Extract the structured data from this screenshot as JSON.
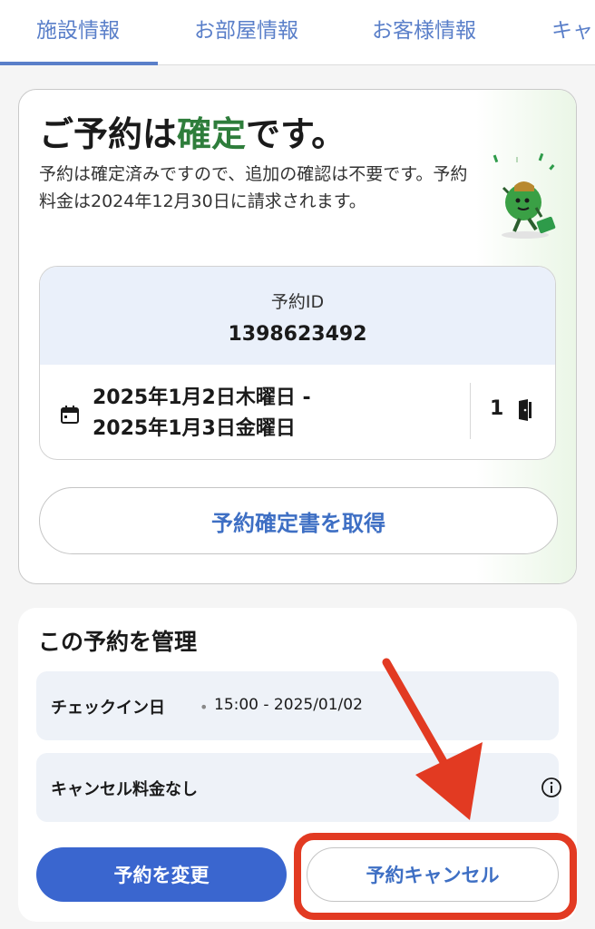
{
  "tabs": [
    {
      "label": "施設情報",
      "active": true
    },
    {
      "label": "お部屋情報"
    },
    {
      "label": "お客様情報"
    },
    {
      "label": "キャ"
    }
  ],
  "confirmation": {
    "title_prefix": "ご予約は",
    "title_accent": "確定",
    "title_suffix": "です。",
    "description": "予約は確定済みですので、追加の確認は不要です。予約料金は2024年12月30日に請求されます。",
    "booking_id_label": "予約ID",
    "booking_id": "1398623492",
    "date_line1": "2025年1月2日木曜日 -",
    "date_line2": "2025年1月3日金曜日",
    "rooms": "1",
    "get_confirmation_label": "予約確定書を取得"
  },
  "manage": {
    "title": "この予約を管理",
    "checkin_label": "チェックイン日",
    "checkin_time": "15:00 - 2025/01/02",
    "cancel_fee_label": "キャンセル料金なし",
    "change_button": "予約を変更",
    "cancel_button": "予約キャンセル"
  },
  "colors": {
    "accent_blue": "#3a66cf",
    "confirmed_green": "#2e7d3b",
    "annotation_red": "#e23a22"
  }
}
